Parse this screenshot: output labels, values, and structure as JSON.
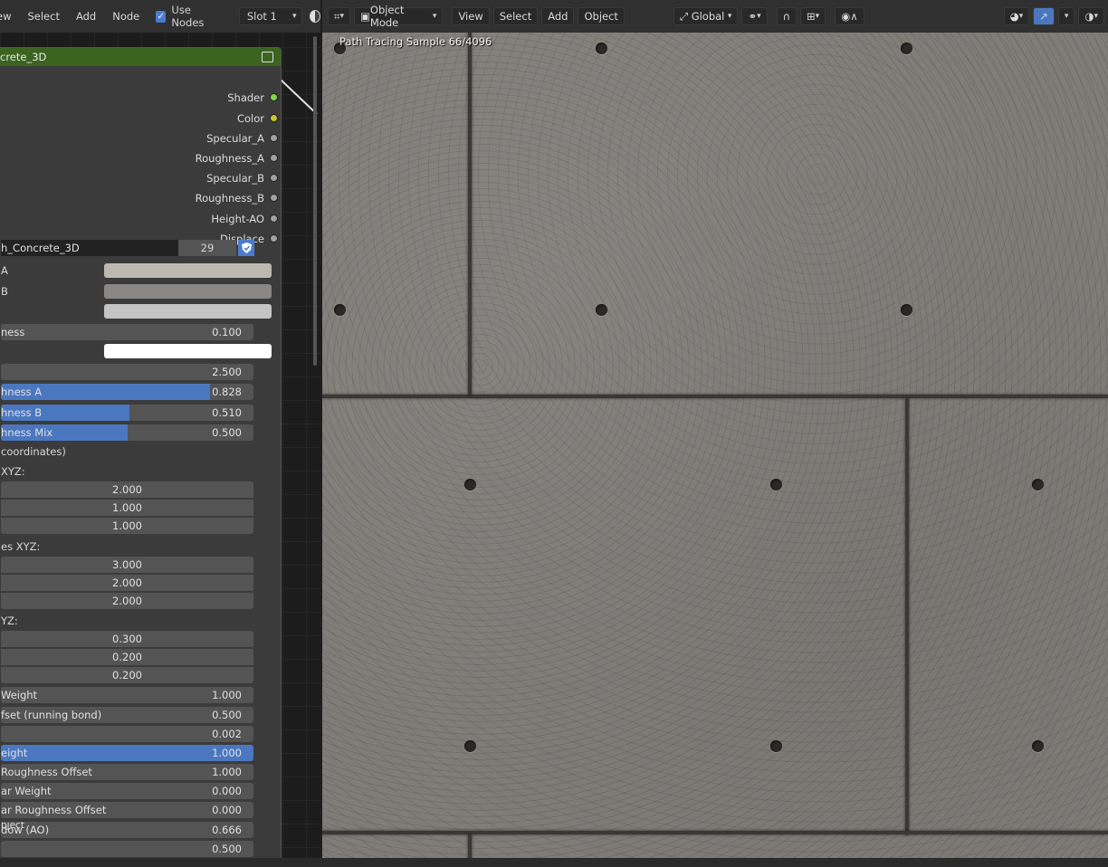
{
  "node_editor": {
    "menu": [
      "ew",
      "Select",
      "Add",
      "Node"
    ],
    "use_nodes_label": "Use Nodes",
    "slot_value": "Slot 1",
    "node": {
      "title": "crete_3D",
      "outputs": [
        {
          "label": "Shader",
          "color": "#7bd84a"
        },
        {
          "label": "Color",
          "color": "#c7c72c"
        },
        {
          "label": "Specular_A",
          "color": "#a1a1a1"
        },
        {
          "label": "Roughness_A",
          "color": "#a1a1a1"
        },
        {
          "label": "Specular_B",
          "color": "#a1a1a1"
        },
        {
          "label": "Roughness_B",
          "color": "#a1a1a1"
        },
        {
          "label": "Height-AO",
          "color": "#a1a1a1"
        },
        {
          "label": "Displace",
          "color": "#a1a1a1"
        }
      ],
      "group_name": "h_Concrete_3D",
      "group_users": "29",
      "color_labels": [
        "A",
        "B",
        ""
      ],
      "colors": [
        "#bdb9b0",
        "#8a8784",
        "#c4c4c4",
        "#ffffff"
      ],
      "params": {
        "ness": {
          "label": "ness",
          "value": "0.100"
        },
        "value_2500": "2.500",
        "rough_a": {
          "label": "hness A",
          "value": "0.828",
          "fill": 0.828
        },
        "rough_b": {
          "label": "hness B",
          "value": "0.510",
          "fill": 0.51
        },
        "rough_mix": {
          "label": "hness Mix",
          "value": "0.500",
          "fill": 0.5
        },
        "coords": "coordinates)",
        "xyz1_label": "XYZ:",
        "xyz1": [
          "2.000",
          "1.000",
          "1.000"
        ],
        "xyz2_label": "es XYZ:",
        "xyz2": [
          "3.000",
          "2.000",
          "2.000"
        ],
        "xyz3_label": "YZ:",
        "xyz3": [
          "0.300",
          "0.200",
          "0.200"
        ],
        "weight": {
          "label": "Weight",
          "value": "1.000"
        },
        "offset": {
          "label": "fset (running bond)",
          "value": "0.500"
        },
        "v0002": "0.002",
        "eight": {
          "label": "eight",
          "value": "1.000",
          "fill": 1.0
        },
        "rough_off": {
          "label": "Roughness Offset",
          "value": "1.000"
        },
        "ar_weight": {
          "label": "ar Weight",
          "value": "0.000"
        },
        "ar_rough_off": {
          "label": "ar Roughness Offset",
          "value": "0.000"
        },
        "ao": {
          "label": "dow (AO)",
          "overlap": "bject",
          "value": "0.666"
        },
        "last": "0.500"
      }
    }
  },
  "viewport": {
    "mode": "Object Mode",
    "menu": [
      "View",
      "Select",
      "Add",
      "Object"
    ],
    "orientation": "Global",
    "overlay_text": "Path Tracing Sample 66/4096"
  }
}
